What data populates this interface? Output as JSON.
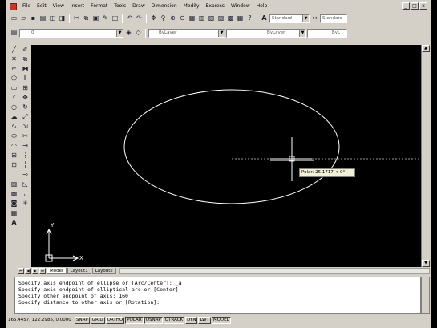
{
  "menubar": {
    "items": [
      "File",
      "Edit",
      "View",
      "Insert",
      "Format",
      "Tools",
      "Draw",
      "Dimension",
      "Modify",
      "Express",
      "Window",
      "Help"
    ],
    "window_buttons": [
      "_",
      "□",
      "x"
    ]
  },
  "styles_toolbar": {
    "text_style": "Standard",
    "dim_style": "Standard"
  },
  "properties_toolbar": {
    "layer_value": "0",
    "color_value": "ByLayer",
    "linetype_value": "ByLayer",
    "lineweight_value": "ByL"
  },
  "drawing": {
    "tooltip": "Polar: 25.1717 < 0°",
    "ucs_x_label": "X",
    "ucs_y_label": "Y"
  },
  "tabs": {
    "model": "Model",
    "layout1": "Layout1",
    "layout2": "Layout2"
  },
  "command_history": [
    "Specify axis endpoint of ellipse or [Arc/Center]: _a",
    "Specify axis endpoint of elliptical arc or [Center]:",
    "Specify other endpoint of axis: 160",
    "Specify distance to other axis or [Rotation]:"
  ],
  "status": {
    "coordinates": "165.4457, 122.2985, 0.0000",
    "buttons": [
      "SNAP",
      "GRID",
      "ORTHO",
      "POLAR",
      "OSNAP",
      "OTRACK",
      "DYN",
      "LWT",
      "MODEL"
    ],
    "active_buttons": [
      "POLAR",
      "OSNAP",
      "OTRACK",
      "MODEL"
    ]
  },
  "colors": {
    "canvas": "#000000",
    "entity": "#ffffff",
    "chrome": "#d4d0c8",
    "accent": "#c0392b"
  }
}
